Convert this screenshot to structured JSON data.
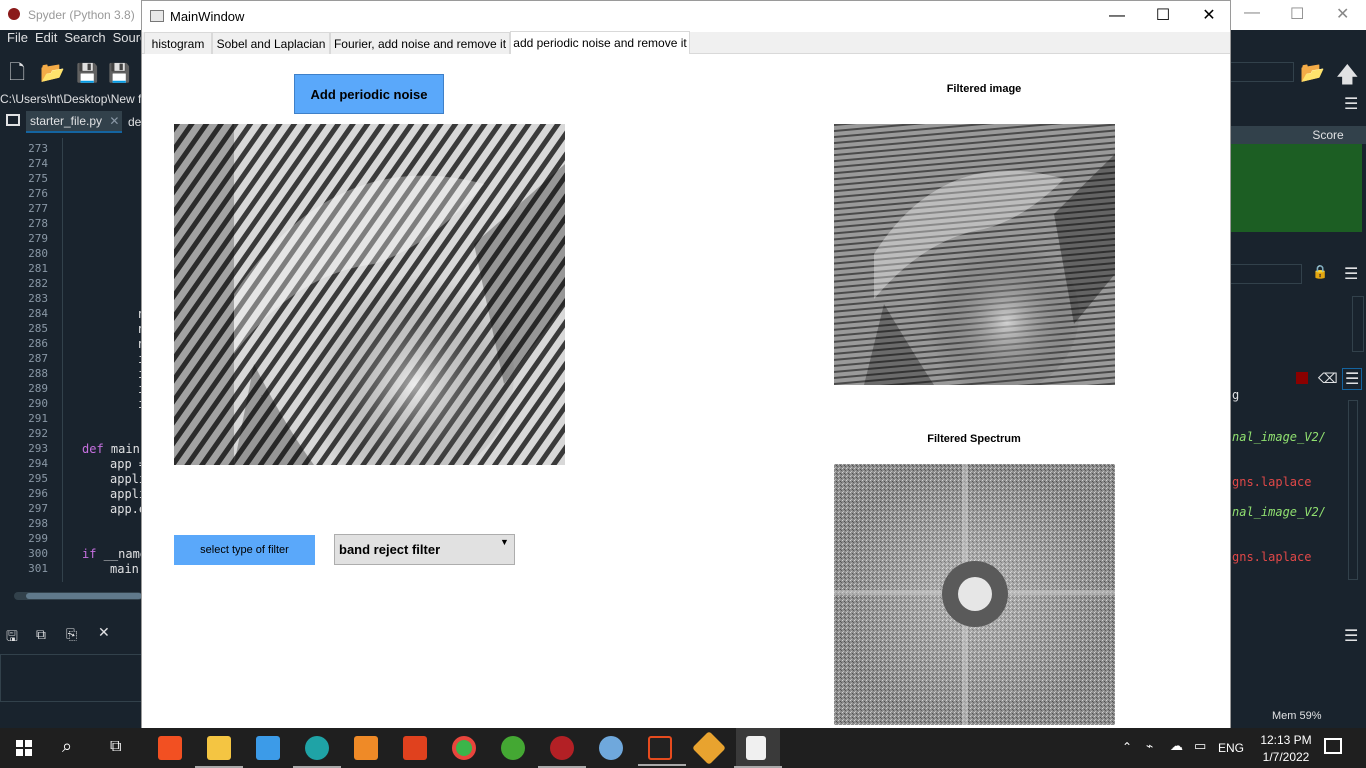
{
  "spyder": {
    "title": "Spyder (Python 3.8)",
    "menu": [
      "File",
      "Edit",
      "Search",
      "Source"
    ],
    "path": "C:\\Users\\ht\\Desktop\\New fo",
    "tabs": [
      "starter_file.py",
      "de"
    ],
    "line_numbers": [
      "273",
      "274",
      "275",
      "276",
      "277",
      "278",
      "279",
      "280",
      "281",
      "282",
      "283",
      "284",
      "285",
      "286",
      "287",
      "288",
      "289",
      "290",
      "291",
      "292",
      "293",
      "294",
      "295",
      "296",
      "297",
      "298",
      "299",
      "300",
      "301"
    ],
    "code": {
      "l284": "n",
      "l285": "n",
      "l286": "n",
      "l287": "i",
      "l288": "i",
      "l289": "i",
      "l290": "i",
      "l293_kw": "def",
      "l293": " main",
      "l294": "app =",
      "l295": "appli",
      "l296": "appli",
      "l297": "app.e",
      "l300_kw": "if",
      "l300": " __name",
      "l301": "main("
    },
    "score_header": "Score",
    "console_lines": [
      "g",
      "nal_image_V2/",
      "gns.laplace",
      "nal_image_V2/",
      "gns.laplace"
    ],
    "mem": "Mem 59%"
  },
  "mainwindow": {
    "title": "MainWindow",
    "tabs": [
      "histogram",
      "Sobel and Laplacian",
      "Fourier, add noise and remove it",
      "add periodic noise and remove it"
    ],
    "active_tab": 3,
    "add_noise_button": "Add periodic noise",
    "filtered_image_caption": "Filtered image",
    "filtered_spectrum_caption": "Filtered Spectrum",
    "filter_label": "select type of filter",
    "filter_select_value": "band reject filter"
  },
  "taskbar": {
    "apps": [
      "store-icon",
      "file-explorer-icon",
      "mail-icon",
      "edge-icon",
      "sublime-icon",
      "office-icon",
      "chrome-icon",
      "anaconda-icon",
      "spyder-icon",
      "paint-icon",
      "matlab-icon",
      "git-icon",
      "notepad-icon"
    ],
    "language": "ENG",
    "time": "12:13 PM",
    "date": "1/7/2022"
  },
  "colors": {
    "accent_button": "#5aa8fa",
    "spyder_bg": "#19232d",
    "score_bg": "#1c5e23"
  }
}
